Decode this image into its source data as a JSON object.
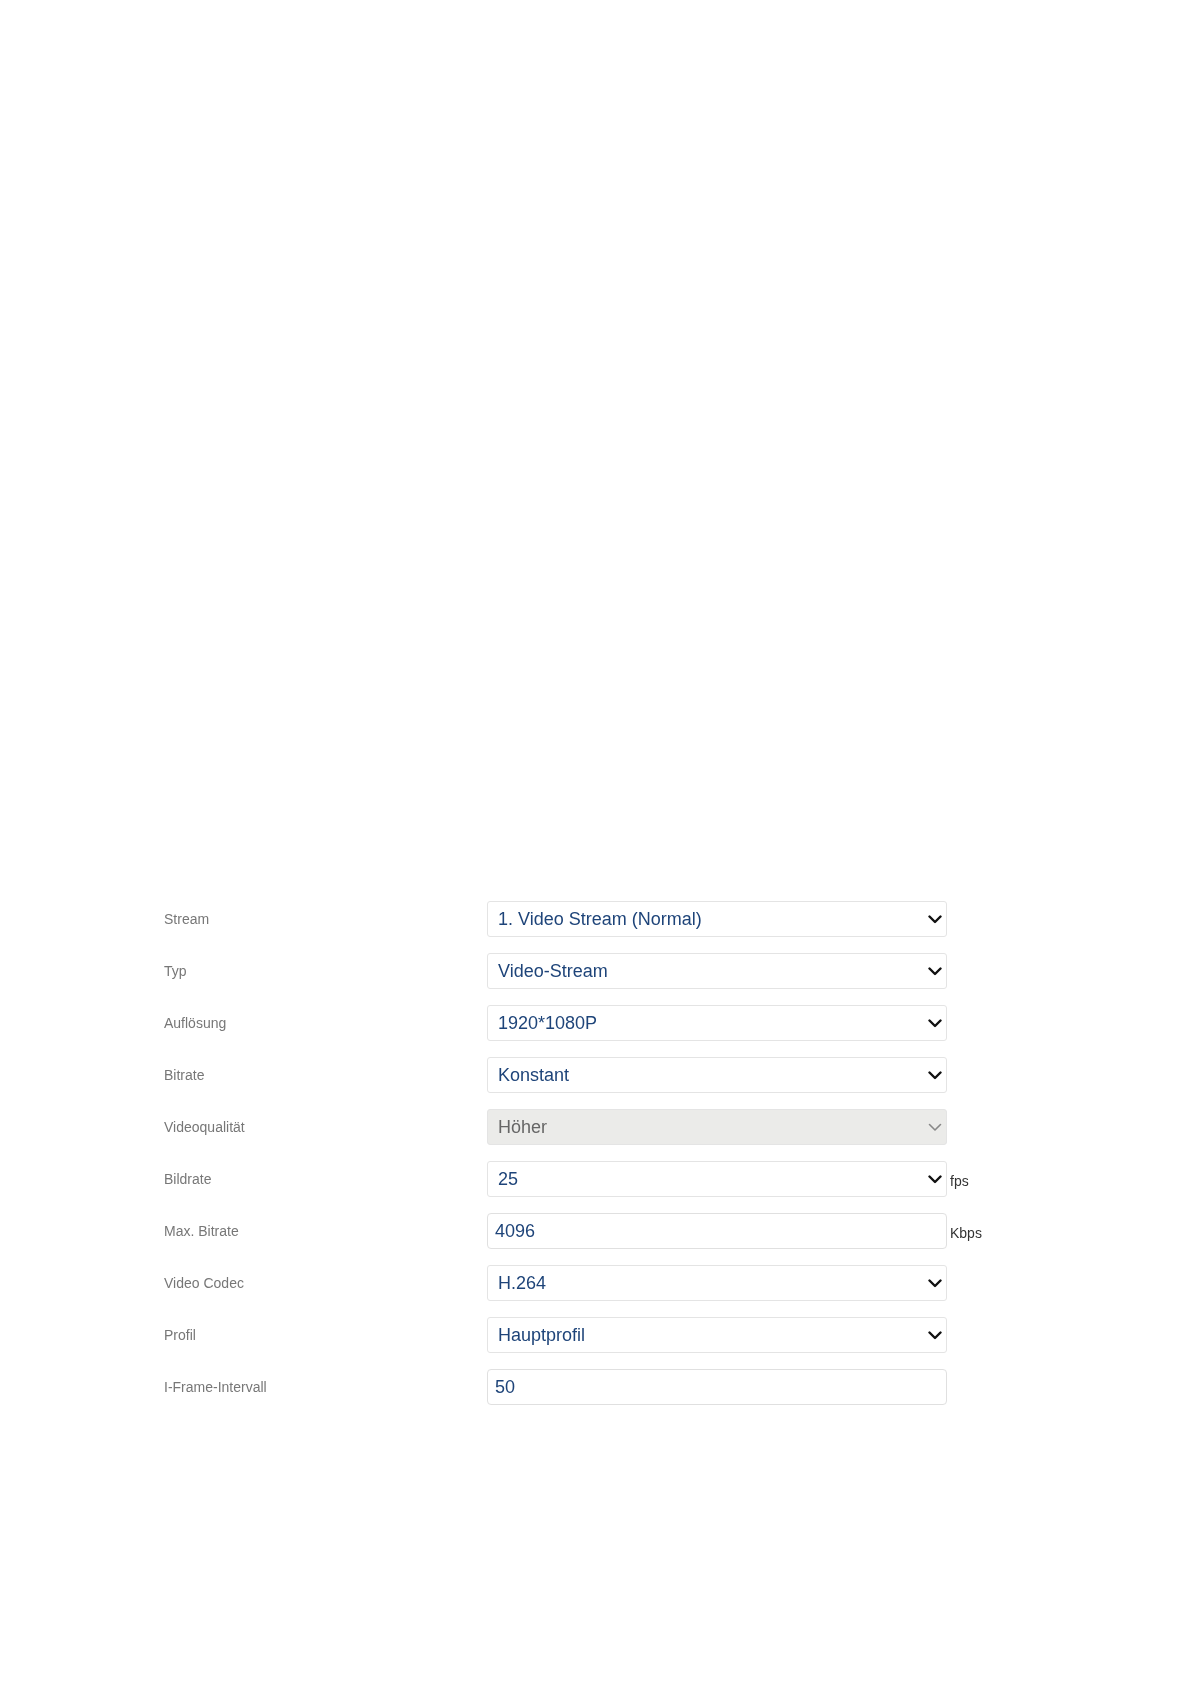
{
  "fields": [
    {
      "label": "Stream",
      "kind": "select",
      "value": "1. Video Stream (Normal)",
      "disabled": false
    },
    {
      "label": "Typ",
      "kind": "select",
      "value": "Video-Stream",
      "disabled": false
    },
    {
      "label": "Auflösung",
      "kind": "select",
      "value": "1920*1080P",
      "disabled": false
    },
    {
      "label": "Bitrate",
      "kind": "select",
      "value": "Konstant",
      "disabled": false
    },
    {
      "label": "Videoqualität",
      "kind": "select",
      "value": "Höher",
      "disabled": true
    },
    {
      "label": "Bildrate",
      "kind": "select",
      "value": "25",
      "disabled": false,
      "unit": "fps"
    },
    {
      "label": "Max. Bitrate",
      "kind": "text",
      "value": "4096",
      "disabled": false,
      "unit": "Kbps"
    },
    {
      "label": "Video Codec",
      "kind": "select",
      "value": "H.264",
      "disabled": false
    },
    {
      "label": "Profil",
      "kind": "select",
      "value": "Hauptprofil",
      "disabled": false
    },
    {
      "label": "I-Frame-Intervall",
      "kind": "text",
      "value": "50",
      "disabled": false
    }
  ]
}
